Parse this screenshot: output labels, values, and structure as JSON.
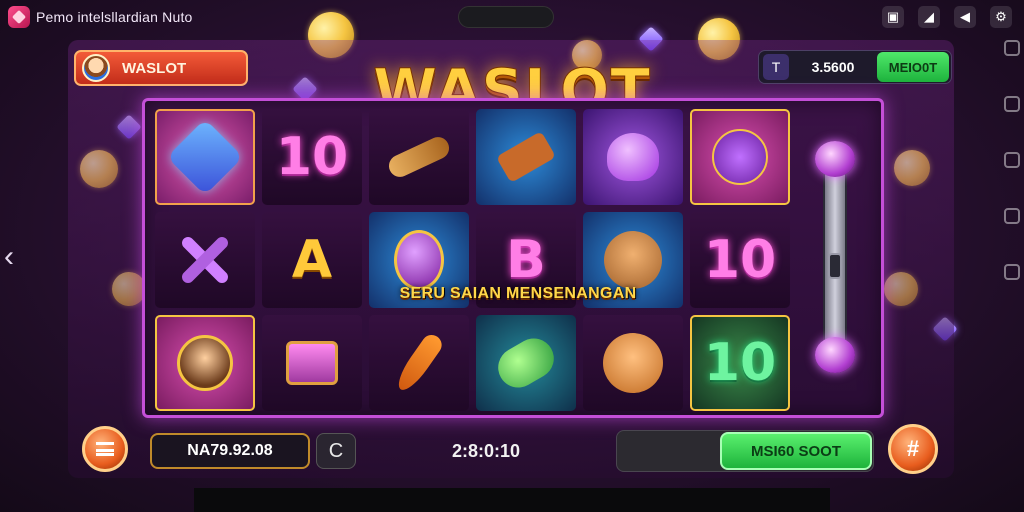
{
  "status_bar": {
    "app_title": "Pemo intelsllardian Nuto",
    "icons": [
      "image-icon",
      "signal-icon",
      "wifi-icon",
      "settings-icon"
    ]
  },
  "header": {
    "player_name": "WASLOT",
    "logo_text": "WASLOT",
    "balance_icon": "T",
    "balance_amount": "3.5600",
    "deposit_label": "MEIO0T"
  },
  "reels": {
    "tiles": [
      {
        "id": "r1c1",
        "symbol": "magic-staff",
        "style": "t-pink",
        "text": ""
      },
      {
        "id": "r1c2",
        "symbol": "number-10",
        "style": "t-dark",
        "text": "10",
        "textStyle": "num-pink"
      },
      {
        "id": "r1c3",
        "symbol": "carrot-bundle",
        "style": "t-dark",
        "text": ""
      },
      {
        "id": "r1c4",
        "symbol": "hammer",
        "style": "t-blue",
        "text": ""
      },
      {
        "id": "r1c5",
        "symbol": "purple-gem-heart",
        "style": "t-violet",
        "text": ""
      },
      {
        "id": "r1c6",
        "symbol": "purple-cat",
        "style": "t-gold",
        "text": ""
      },
      {
        "id": "r2c1",
        "symbol": "crossed-bones",
        "style": "t-dark",
        "text": ""
      },
      {
        "id": "r2c2",
        "symbol": "letter-a",
        "style": "t-dark",
        "text": "A",
        "textStyle": "num-gold"
      },
      {
        "id": "r2c3",
        "symbol": "magic-egg",
        "style": "t-blue",
        "text": ""
      },
      {
        "id": "r2c4",
        "symbol": "letter-b",
        "style": "t-dark",
        "text": "B",
        "textStyle": "num-pink"
      },
      {
        "id": "r2c5",
        "symbol": "cat-character",
        "style": "t-blue",
        "text": ""
      },
      {
        "id": "r2c6",
        "symbol": "number-10-pink",
        "style": "t-dark",
        "text": "10",
        "textStyle": "num-pink"
      },
      {
        "id": "r3c1",
        "symbol": "hero-character",
        "style": "t-gold",
        "text": ""
      },
      {
        "id": "r3c2",
        "symbol": "gift-box",
        "style": "t-dark",
        "text": ""
      },
      {
        "id": "r3c3",
        "symbol": "carrot",
        "style": "t-dark",
        "text": ""
      },
      {
        "id": "r3c4",
        "symbol": "green-gem",
        "style": "t-teal",
        "text": ""
      },
      {
        "id": "r3c5",
        "symbol": "orange-cat",
        "style": "t-dark",
        "text": ""
      },
      {
        "id": "r3c6",
        "symbol": "number-10-green",
        "style": "t-green",
        "text": "10",
        "textStyle": "num-green"
      }
    ],
    "banner_text": "SERU SAIAN MENSENANGAN"
  },
  "footer": {
    "bet_amount": "NA79.92.08",
    "refresh_icon": "C",
    "timer": "2:8:0:10",
    "spin_label": "MSI60 SOOT",
    "autoplay_icon": "#"
  },
  "colors": {
    "accent_gold": "#ffcf3f",
    "frame_magenta": "#c44fd8",
    "spin_green": "#1db33b",
    "badge_red": "#c22d1a"
  }
}
